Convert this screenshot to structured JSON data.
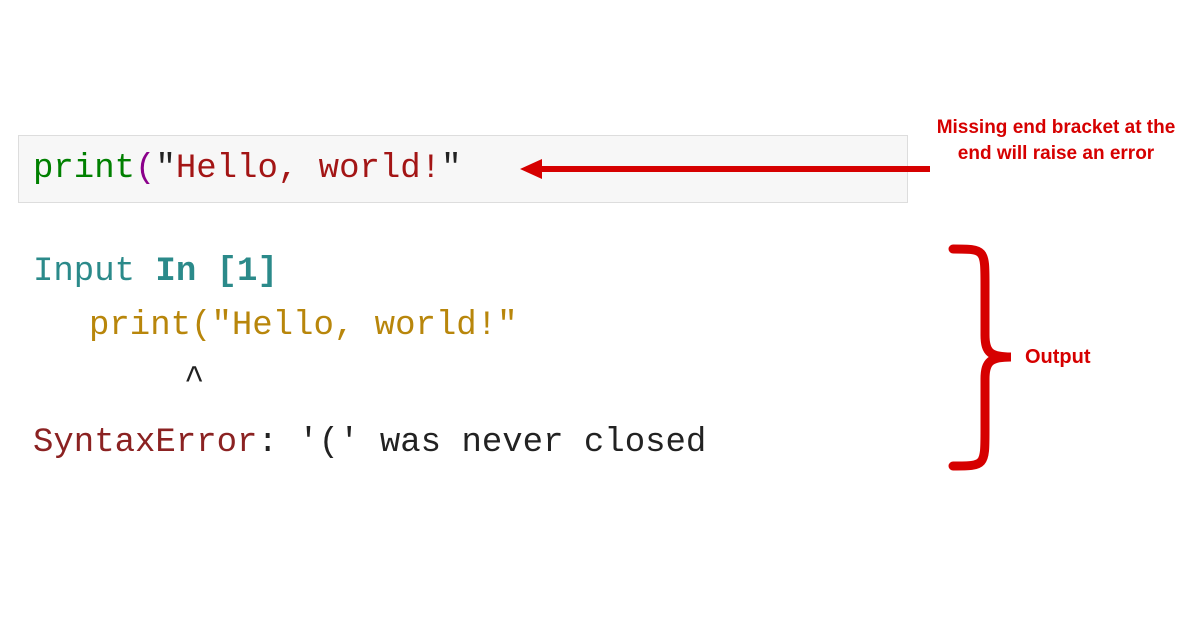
{
  "code_cell": {
    "fn": "print",
    "lparen": "(",
    "quote1": "\"",
    "string": "Hello, world!",
    "quote2": "\""
  },
  "output": {
    "input_label_prefix": "Input ",
    "input_label_bold": "In [1]",
    "echo_fn": "print",
    "echo_lparen": "(",
    "echo_quote1": "\"",
    "echo_string": "Hello, world!",
    "echo_quote2": "\"",
    "caret": "^",
    "error_name": "SyntaxError",
    "error_colon": ": ",
    "error_msg": "'(' was never closed"
  },
  "annotations": {
    "missing_bracket": "Missing end bracket at the end will raise an error",
    "output_label": "Output"
  }
}
